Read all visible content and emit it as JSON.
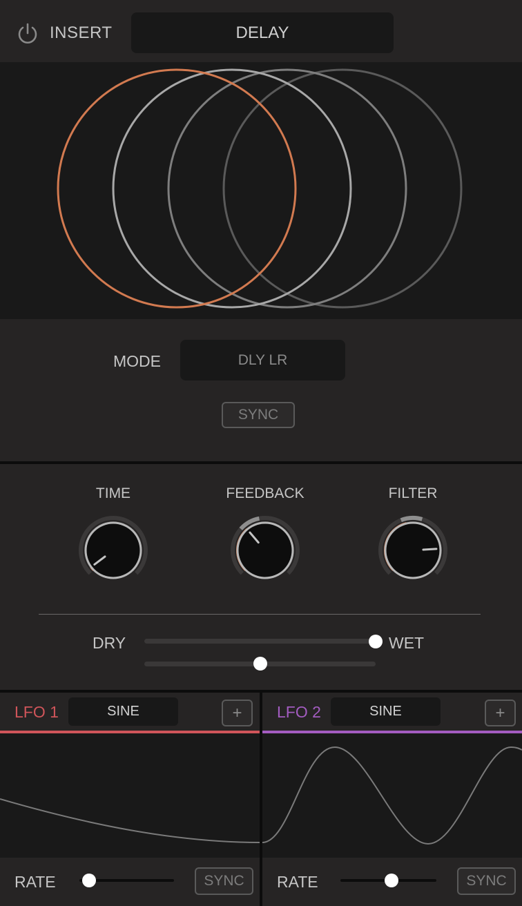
{
  "header": {
    "insert_label": "INSERT",
    "preset_name": "DELAY"
  },
  "visualizer": {
    "rings": [
      {
        "color": "#d27a50"
      },
      {
        "color": "#a8a8a8"
      },
      {
        "color": "#7e7e7e"
      },
      {
        "color": "#5a5a5a"
      }
    ]
  },
  "mode": {
    "label": "MODE",
    "value": "DLY LR",
    "sync_label": "SYNC"
  },
  "knobs": [
    {
      "label": "TIME",
      "value": 0.03,
      "mod_amount": 0.03
    },
    {
      "label": "FEEDBACK",
      "value": 0.35,
      "mod_amount": 0.35
    },
    {
      "label": "FILTER",
      "value": 0.82,
      "mod_amount": 0.45
    }
  ],
  "mix": {
    "dry_label": "DRY",
    "wet_label": "WET",
    "dry_wet": 1.0,
    "secondary": 0.5
  },
  "lfo1": {
    "title": "LFO 1",
    "shape": "SINE",
    "add_label": "+",
    "color": "#d0555a",
    "rate_label": "RATE",
    "rate": 0.1,
    "sync_label": "SYNC"
  },
  "lfo2": {
    "title": "LFO 2",
    "shape": "SINE",
    "add_label": "+",
    "color": "#a35cc0",
    "rate_label": "RATE",
    "rate": 0.53,
    "sync_label": "SYNC"
  },
  "colors": {
    "accent": "#d27a50",
    "panel": "#262424",
    "dark": "#191919"
  }
}
